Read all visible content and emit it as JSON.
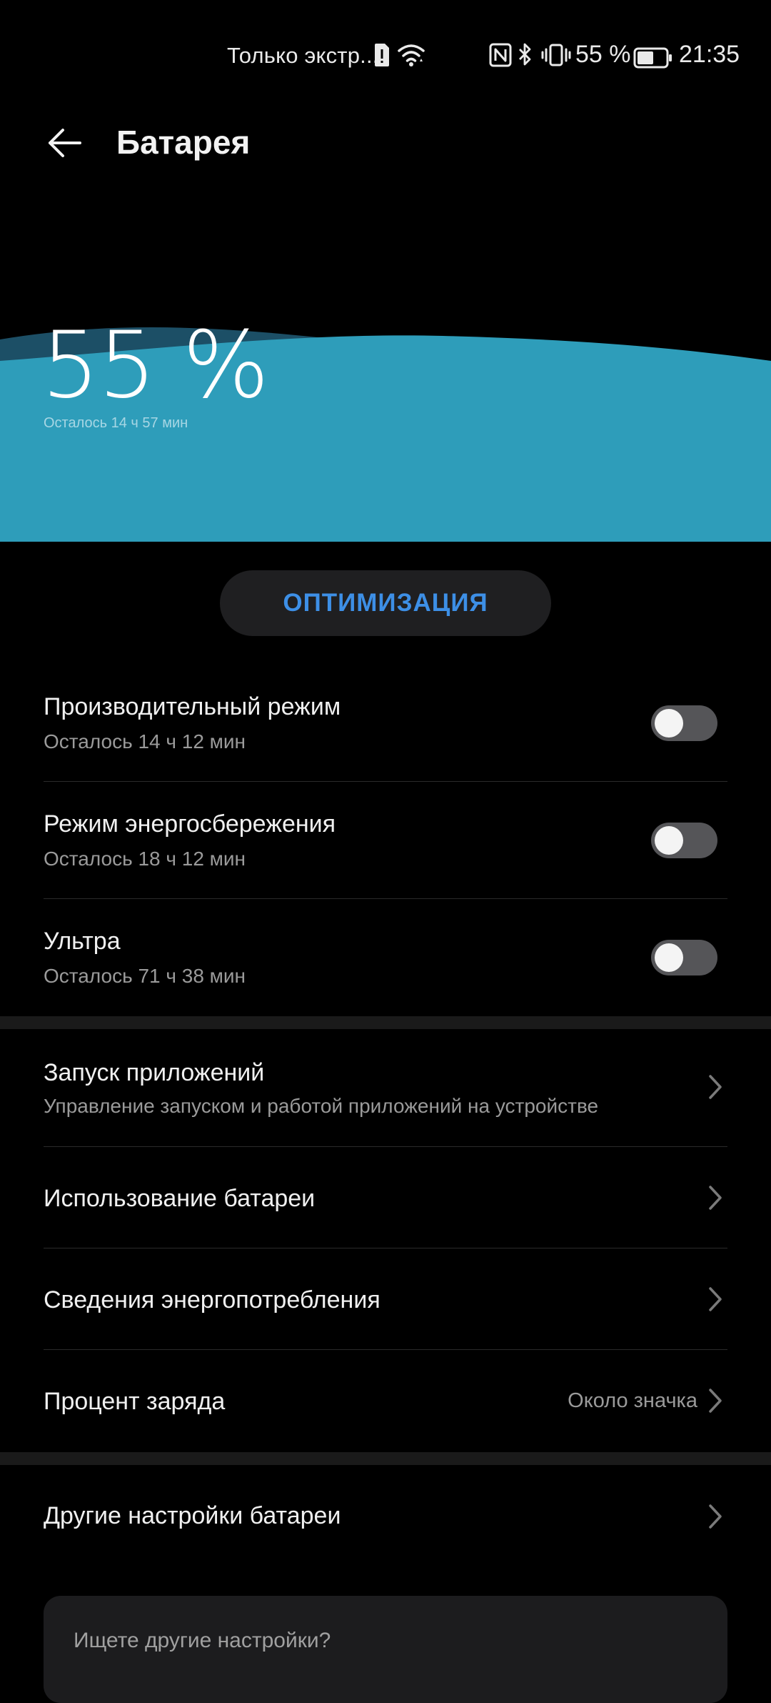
{
  "status_bar": {
    "carrier": "Только экстр....",
    "battery_percent": "55 %",
    "time": "21:35",
    "icons": [
      "sim-alert-icon",
      "wifi-icon",
      "nfc-icon",
      "bluetooth-icon",
      "vibrate-icon",
      "battery-icon"
    ]
  },
  "header": {
    "title": "Батарея",
    "back_icon": "arrow-left-icon"
  },
  "battery": {
    "level": "55 %",
    "remaining": "Осталось 14 ч 57 мин",
    "wave_color": "#2e9dba",
    "wave_dark_color": "#1c4f66"
  },
  "optimize": {
    "label": "ОПТИМИЗАЦИЯ",
    "color": "#3d8fe6"
  },
  "modes": [
    {
      "title": "Производительный режим",
      "subtitle": "Осталось 14 ч 12 мин",
      "enabled": false
    },
    {
      "title": "Режим энергосбережения",
      "subtitle": "Осталось 18 ч 12 мин",
      "enabled": false
    },
    {
      "title": "Ультра",
      "subtitle": "Осталось 71 ч 38 мин",
      "enabled": false
    }
  ],
  "settings": [
    {
      "title": "Запуск приложений",
      "subtitle": "Управление запуском и работой приложений на устройстве"
    },
    {
      "title": "Использование батареи"
    },
    {
      "title": "Сведения энергопотребления"
    },
    {
      "title": "Процент заряда",
      "value": "Около значка"
    }
  ],
  "other": {
    "title": "Другие настройки батареи"
  },
  "search_card": {
    "text": "Ищете другие настройки?"
  }
}
